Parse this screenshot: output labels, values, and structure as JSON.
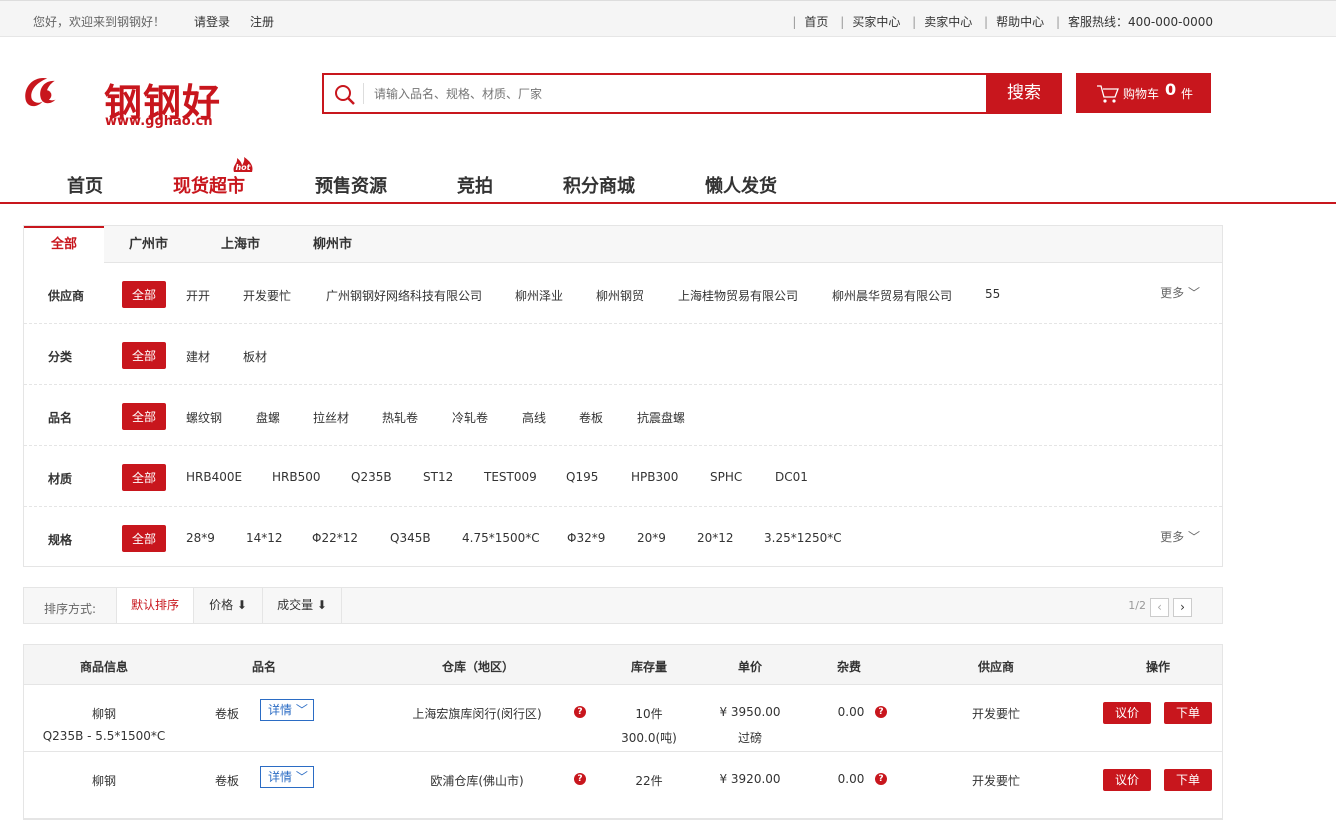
{
  "topbar": {
    "welcome": "您好，欢迎来到钢钢好！",
    "login": "请登录",
    "register": "注册",
    "links": [
      "首页",
      "买家中心",
      "卖家中心",
      "帮助中心",
      "客服热线：400-000-0000"
    ]
  },
  "header": {
    "logo_text": "钢钢好",
    "logo_url": "www.gghao.cn",
    "search_placeholder": "请输入品名、规格、材质、厂家",
    "search_button": "搜索",
    "cart_label": "购物车",
    "cart_count": "0",
    "cart_unit": "件"
  },
  "nav": {
    "items": [
      "首页",
      "现货超市",
      "预售资源",
      "竞拍",
      "积分商城",
      "懒人发货"
    ],
    "hot_badge": "hot"
  },
  "filter": {
    "tabs": [
      "全部",
      "广州市",
      "上海市",
      "柳州市"
    ],
    "more": "更多",
    "rows": [
      {
        "label": "供应商",
        "options": [
          "全部",
          "开开",
          "开发要忙",
          "广州钢钢好网络科技有限公司",
          "柳州泽业",
          "柳州钢贸",
          "上海桂物贸易有限公司",
          "柳州晨华贸易有限公司",
          "55"
        ]
      },
      {
        "label": "分类",
        "options": [
          "全部",
          "建材",
          "板材"
        ]
      },
      {
        "label": "品名",
        "options": [
          "全部",
          "螺纹钢",
          "盘螺",
          "拉丝材",
          "热轧卷",
          "冷轧卷",
          "高线",
          "卷板",
          "抗震盘螺"
        ]
      },
      {
        "label": "材质",
        "options": [
          "全部",
          "HRB400E",
          "HRB500",
          "Q235B",
          "ST12",
          "TEST009",
          "Q195",
          "HPB300",
          "SPHC",
          "DC01"
        ]
      },
      {
        "label": "规格",
        "options": [
          "全部",
          "28*9",
          "14*12",
          "Φ22*12",
          "Q345B",
          "4.75*1500*C",
          "Φ32*9",
          "20*9",
          "20*12",
          "3.25*1250*C"
        ]
      }
    ]
  },
  "sort": {
    "label": "排序方式:",
    "tabs": [
      "默认排序",
      "价格 ⬇",
      "成交量 ⬇"
    ],
    "pager": "1/2"
  },
  "table": {
    "headers": [
      "商品信息",
      "品名",
      "仓库（地区）",
      "库存量",
      "单价",
      "杂费",
      "供应商",
      "操作"
    ],
    "detail_label": "详情",
    "bargain_label": "议价",
    "order_label": "下单",
    "rows": [
      {
        "brand": "柳钢",
        "spec": "Q235B - 5.5*1500*C",
        "name": "卷板",
        "warehouse": "上海宏旗库闵行(闵行区)",
        "stock": "10件",
        "weight": "300.0(吨)",
        "price": "¥ 3950.00",
        "price_note": "过磅",
        "fee": "0.00",
        "supplier": "开发要忙"
      },
      {
        "brand": "柳钢",
        "spec": "",
        "name": "卷板",
        "warehouse": "欧浦仓库(佛山市)",
        "stock": "22件",
        "weight": "",
        "price": "¥ 3920.00",
        "price_note": "",
        "fee": "0.00",
        "supplier": "开发要忙"
      }
    ]
  }
}
